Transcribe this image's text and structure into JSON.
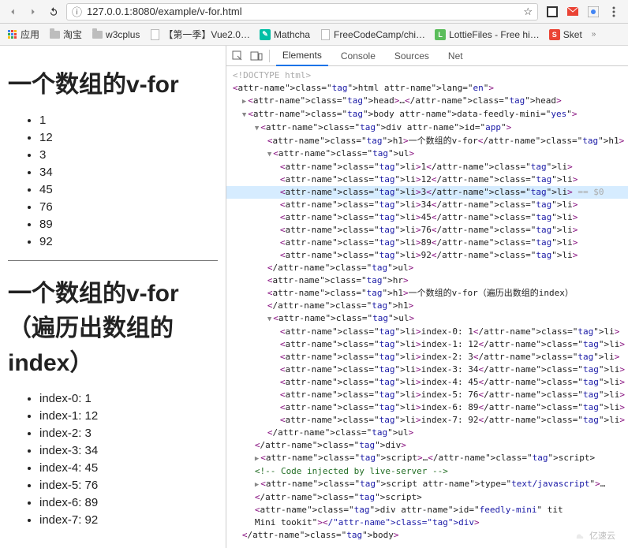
{
  "browser": {
    "url": "127.0.0.1:8080/example/v-for.html",
    "bookmarks": [
      {
        "label": "应用",
        "icon": "apps"
      },
      {
        "label": "淘宝",
        "icon": "folder"
      },
      {
        "label": "w3cplus",
        "icon": "folder"
      },
      {
        "label": "【第一季】Vue2.0…",
        "icon": "page"
      },
      {
        "label": "Mathcha",
        "icon": "teal"
      },
      {
        "label": "FreeCodeCamp/chi…",
        "icon": "page"
      },
      {
        "label": "LottieFiles - Free hi…",
        "icon": "green"
      },
      {
        "label": "Sket",
        "icon": "red"
      }
    ]
  },
  "content": {
    "heading1": "一个数组的v-for",
    "heading2": "一个数组的v-for（遍历出数组的index）",
    "items": [
      "1",
      "12",
      "3",
      "34",
      "45",
      "76",
      "89",
      "92"
    ],
    "items_indexed": [
      "index-0: 1",
      "index-1: 12",
      "index-2: 3",
      "index-3: 34",
      "index-4: 45",
      "index-5: 76",
      "index-6: 89",
      "index-7: 92"
    ]
  },
  "devtools": {
    "tabs": [
      "Elements",
      "Console",
      "Sources",
      "Net"
    ],
    "active_tab": "Elements",
    "highlight_suffix": " == $0",
    "dom": {
      "doctype": "<!DOCTYPE html>",
      "html_open": "<html lang=\"en\">",
      "head": "<head>…</head>",
      "body_open": "<body data-feedly-mini=\"yes\">",
      "div_open": "<div id=\"app\">",
      "h1a": "一个数组的v-for",
      "li_items": [
        "1",
        "12",
        "3",
        "34",
        "45",
        "76",
        "89",
        "92"
      ],
      "hr": "<hr>",
      "h1b": "一个数组的v-for（遍历出数组的index）",
      "li_indexed": [
        "index-0: 1",
        "index-1: 12",
        "index-2: 3",
        "index-3: 34",
        "index-4: 45",
        "index-5: 76",
        "index-6: 89",
        "index-7: 92"
      ],
      "div_close": "</div>",
      "script1": "<script>…</script",
      "comment": "<!-- Code injected by live-server -->",
      "script2_open": "<script type=\"text/javascript\">…",
      "script2_close": "</script",
      "feedly_open": "<div id=\"feedly-mini\" tit",
      "feedly_close": "Mini tookit\"></div>",
      "body_close": "</body>"
    }
  },
  "watermark": "亿速云"
}
